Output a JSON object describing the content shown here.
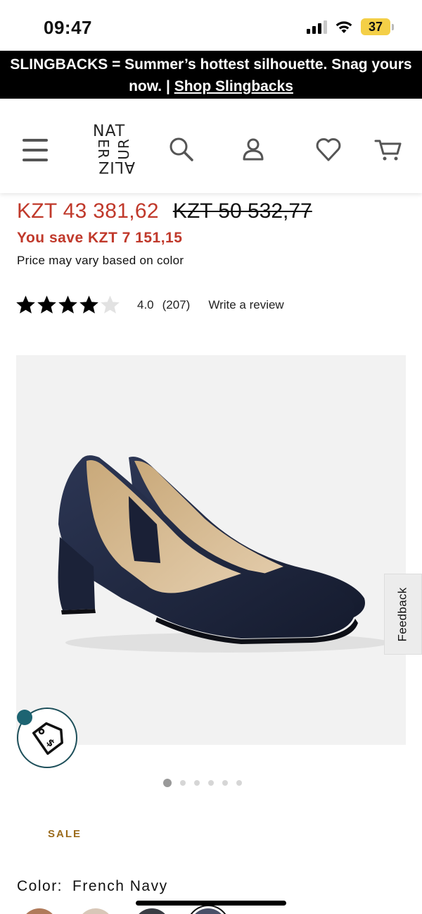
{
  "status_bar": {
    "time": "09:47",
    "battery": "37"
  },
  "promo": {
    "text": "SLINGBACKS = Summer’s hottest silhouette. Snag yours now. | ",
    "link_label": "Shop Slingbacks"
  },
  "header": {
    "logo": {
      "line1": "NAT",
      "line2_left": "ER",
      "line2_right": "UR",
      "line3": "ALIZ"
    },
    "icons": [
      "menu-icon",
      "search-icon",
      "account-icon",
      "heart-icon",
      "cart-icon"
    ]
  },
  "price": {
    "sale": "KZT 43 381,62",
    "original": "KZT 50 532,77",
    "savings": "You save KZT 7 151,15",
    "note": "Price may vary based on color"
  },
  "rating": {
    "value": "4.0",
    "count": "(207)",
    "stars_filled": 4,
    "stars_total": 5,
    "write_review": "Write a review"
  },
  "product_image": {
    "feedback_label": "Feedback",
    "dots_total": 6,
    "active_dot": 0
  },
  "sale_label": "SALE",
  "color": {
    "label": "Color:",
    "value": "French Navy",
    "swatches": [
      "#b07a5a",
      "#d8c7b8",
      "#3a3d44",
      "#4a5068"
    ]
  },
  "colors": {
    "sale_red": "#c0392b",
    "banner_bg": "#000000",
    "sale_label": "#9b6b1c",
    "badge_teal": "#1d6472",
    "shoe_navy": "#1f2740"
  }
}
